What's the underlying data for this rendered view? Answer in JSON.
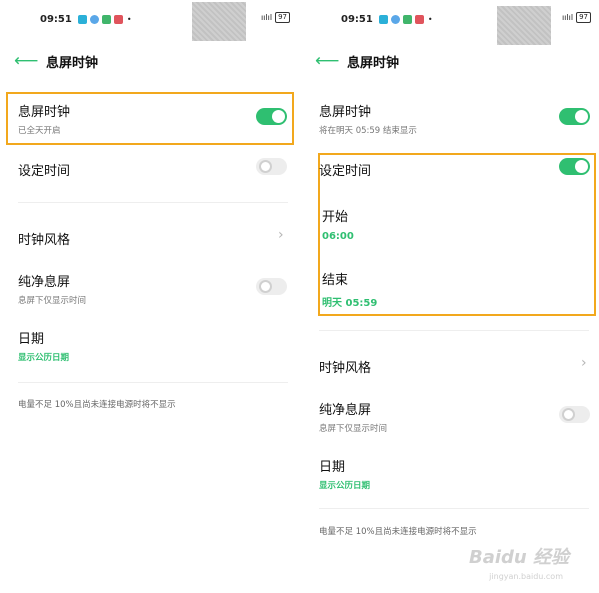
{
  "left": {
    "status": {
      "time": "09:51",
      "bullet": "•",
      "signal": "ıılıl",
      "battery": "97"
    },
    "header": {
      "title": "息屏时钟"
    },
    "aod_clock": {
      "title": "息屏时钟",
      "subtitle": "已全天开启"
    },
    "set_time": {
      "title": "设定时间"
    },
    "clock_style": {
      "title": "时钟风格"
    },
    "pure_aod": {
      "title": "纯净息屏",
      "subtitle": "息屏下仅显示时间"
    },
    "date": {
      "title": "日期",
      "value": "显示公历日期"
    },
    "note": "电量不足 10%且尚未连接电源时将不显示"
  },
  "right": {
    "status": {
      "time": "09:51",
      "bullet": "•",
      "signal": "ıılıl",
      "battery": "97"
    },
    "header": {
      "title": "息屏时钟"
    },
    "aod_clock": {
      "title": "息屏时钟",
      "subtitle": "将在明天 05:59 结束显示"
    },
    "set_time": {
      "title": "设定时间"
    },
    "start": {
      "label": "开始",
      "value": "06:00"
    },
    "end": {
      "label": "结束",
      "value": "明天 05:59"
    },
    "clock_style": {
      "title": "时钟风格"
    },
    "pure_aod": {
      "title": "纯净息屏",
      "subtitle": "息屏下仅显示时间"
    },
    "date": {
      "title": "日期",
      "value": "显示公历日期"
    },
    "note": "电量不足 10%且尚未连接电源时将不显示"
  },
  "watermark": {
    "brand": "Baidu 经验",
    "url": "jingyan.baidu.com"
  },
  "colors": {
    "accent": "#2fbf71",
    "highlight": "#f2a81d"
  },
  "icons": [
    "back-arrow-icon",
    "chevron-right-icon",
    "signal-icon",
    "battery-icon"
  ]
}
